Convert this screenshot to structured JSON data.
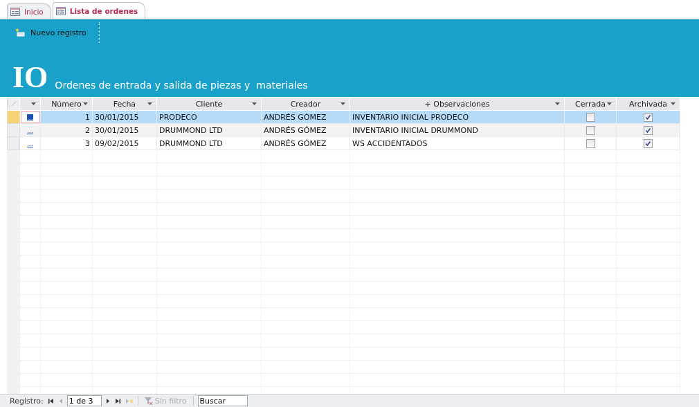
{
  "tabs": [
    {
      "label": "Inicio",
      "selected": false
    },
    {
      "label": "Lista de ordenes",
      "selected": true
    }
  ],
  "toolbar": {
    "new_record": "Nuevo registro"
  },
  "header": {
    "logo": "IO",
    "title": "Ordenes de entrada y salida de piezas y  materiales"
  },
  "table": {
    "columns": [
      {
        "kind": "link"
      },
      {
        "label": "Número",
        "kind": "num"
      },
      {
        "label": "Fecha",
        "kind": "text"
      },
      {
        "label": "Cliente",
        "kind": "text"
      },
      {
        "label": "Creador",
        "kind": "text"
      },
      {
        "label": "+ Observaciones",
        "kind": "text"
      },
      {
        "label": "Cerrada",
        "kind": "check"
      },
      {
        "label": "Archivada",
        "kind": "check"
      }
    ],
    "rows": [
      {
        "selected": true,
        "link": "...",
        "numero": "1",
        "fecha": "30/01/2015",
        "cliente": "PRODECO",
        "creador": "ANDRÉS GÓMEZ",
        "observaciones": "INVENTARIO INICIAL PRODECO",
        "cerrada": false,
        "archivada": true
      },
      {
        "selected": false,
        "link": "...",
        "numero": "2",
        "fecha": "30/01/2015",
        "cliente": "DRUMMOND LTD",
        "creador": "ANDRÉS GÓMEZ",
        "observaciones": "INVENTARIO INICIAL DRUMMOND",
        "cerrada": false,
        "archivada": true
      },
      {
        "selected": false,
        "link": "...",
        "numero": "3",
        "fecha": "09/02/2015",
        "cliente": "DRUMMOND LTD",
        "creador": "ANDRÉS GÓMEZ",
        "observaciones": "WS ACCIDENTADOS",
        "cerrada": false,
        "archivada": true
      }
    ]
  },
  "status_bar": {
    "label": "Registro:",
    "position": "1 de 3",
    "filter": {
      "label": "Sin filtro",
      "disabled": true
    },
    "search": {
      "placeholder": "Buscar"
    }
  }
}
